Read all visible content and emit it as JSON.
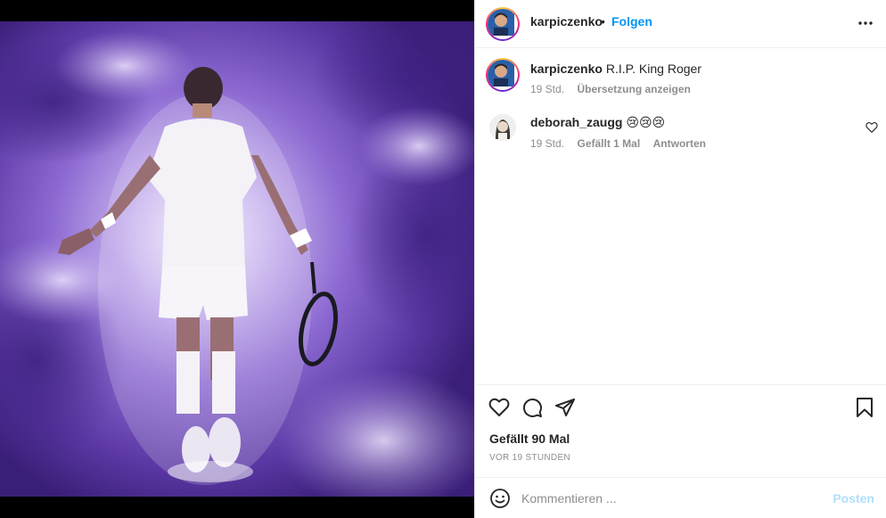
{
  "post": {
    "author": "karpiczenko",
    "follow_label": "Folgen",
    "separator": "•",
    "caption_user": "karpiczenko",
    "caption_text": "R.I.P. King Roger",
    "caption_time": "19 Std.",
    "translate_label": "Übersetzung anzeigen"
  },
  "comments": [
    {
      "user": "deborah_zaugg",
      "text": "😢😢😢",
      "time": "19 Std.",
      "likes": "Gefällt 1 Mal",
      "reply_label": "Antworten"
    }
  ],
  "actions": {
    "likes_text": "Gefällt 90 Mal",
    "time_text": "VOR 19 STUNDEN"
  },
  "comment_box": {
    "placeholder": "Kommentieren ...",
    "post_label": "Posten"
  },
  "colors": {
    "accent": "#0095f6",
    "post_disabled": "#b2dffc",
    "muted": "#8e8e8e"
  },
  "icons": [
    "more-icon",
    "heart-icon",
    "comment-icon",
    "share-icon",
    "bookmark-icon",
    "emoji-icon"
  ]
}
